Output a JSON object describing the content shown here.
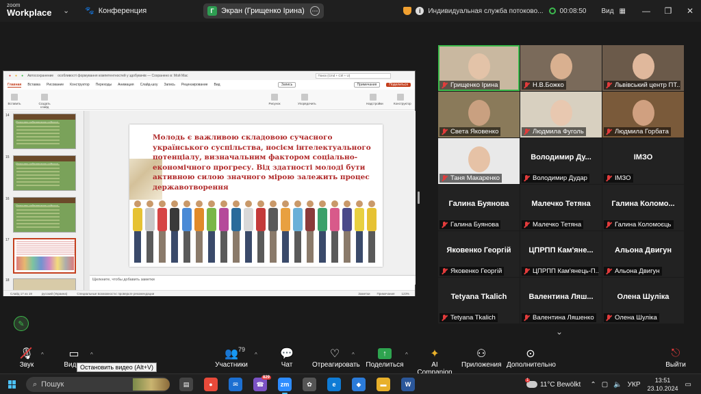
{
  "titlebar": {
    "logo_top": "zoom",
    "logo_bottom": "Workplace",
    "conference": "Конференция",
    "screen_label": "Экран (Грищенко Ірина)",
    "screen_initial": "Г",
    "service": "Индивидуальная служба потоково...",
    "timer": "00:08:50",
    "view": "Вид"
  },
  "ppt": {
    "autosave": "Автосохранение",
    "doc_title": "особливості формування компетентностей у здобувачів — Сохранено в: Мой Mac",
    "search": "Поиск (Cmd + Ctrl + U)",
    "tabs": [
      "Главная",
      "Вставка",
      "Рисование",
      "Конструктор",
      "Переходы",
      "Анимация",
      "Слайд-шоу",
      "Запись",
      "Рецензирование",
      "Вид"
    ],
    "record_btn": "Запись",
    "notes_btn": "Примечания",
    "share_btn": "Поделиться",
    "ribbon": [
      "Вставить",
      "Создать слайд",
      "Рисунок",
      "Упорядочить",
      "Конструктор",
      "Надстройки"
    ],
    "thumb_title": "Принципи забезпечення стійкості",
    "thumb_numbers": [
      "14",
      "15",
      "16",
      "17",
      "18"
    ],
    "slide_text": "Молодь є важливою складовою сучасного українського суспільства,  носієм інтелектуального потенціалу, визначальним фактором соціально-економічного прогресу. Від здатності молоді бути активною силою значного мірою залежить   процес  державотворення",
    "notes_placeholder": "Щелкните, чтобы добавить заметки",
    "status_slide": "Слайд 17 из 19",
    "status_lang": "русский (Украина)",
    "status_access": "Специальные возможности: проверьте рекомендации",
    "status_notes": "Заметки",
    "status_comments": "Примечания",
    "zoom": "123%"
  },
  "gallery": [
    {
      "tag": "Грищенко Ірина",
      "big": "",
      "video": true,
      "active": true
    },
    {
      "tag": "Н.В.Божко",
      "big": "",
      "video": true
    },
    {
      "tag": "Львівський центр ПТ...",
      "big": "",
      "video": true
    },
    {
      "tag": "Света Яковенко",
      "big": "",
      "video": true
    },
    {
      "tag": "Людмила Фуголь",
      "big": "",
      "video": true
    },
    {
      "tag": "Людмила Горбата",
      "big": "",
      "video": true
    },
    {
      "tag": "Таня Макаренко",
      "big": "",
      "video": true
    },
    {
      "tag": "Володимир Дудар",
      "big": "Володимир  Ду...",
      "video": false
    },
    {
      "tag": "IMЗО",
      "big": "IMЗО",
      "video": false
    },
    {
      "tag": "Галина Буянова",
      "big": "Галина Буянова",
      "video": false
    },
    {
      "tag": "Малечко Тетяна",
      "big": "Малечко Тетяна",
      "video": false
    },
    {
      "tag": "Галина Коломоєць",
      "big": "Галина  Коломо...",
      "video": false
    },
    {
      "tag": "Яковенко Георгій",
      "big": "Яковенко Георгій",
      "video": false
    },
    {
      "tag": "ЦПРПП Кам'янець-П...",
      "big": "ЦПРПП  Кам'янe...",
      "video": false
    },
    {
      "tag": "Альона Двигун",
      "big": "Альона Двигун",
      "video": false
    },
    {
      "tag": "Tetyana Tkalich",
      "big": "Tetyana Tkalich",
      "video": false
    },
    {
      "tag": "Валентина Ляшенко",
      "big": "Валентина  Ляш...",
      "video": false
    },
    {
      "tag": "Олена Шуліка",
      "big": "Олена Шуліка",
      "video": false
    }
  ],
  "toolbar": {
    "audio": "Звук",
    "video": "Видео",
    "participants": "Участники",
    "participants_count": "79",
    "chat": "Чат",
    "react": "Отреагировать",
    "share": "Поделиться",
    "ai": "AI Companion",
    "apps": "Приложения",
    "more": "Дополнительно",
    "leave": "Выйти",
    "tooltip": "Остановить видео (Alt+V)"
  },
  "taskbar": {
    "search": "Пошук",
    "weather": "11°C  Bewölkt",
    "weather_badge": "1",
    "lang": "УКР",
    "time": "13:51",
    "date": "23.10.2024",
    "viber_badge": "829"
  }
}
